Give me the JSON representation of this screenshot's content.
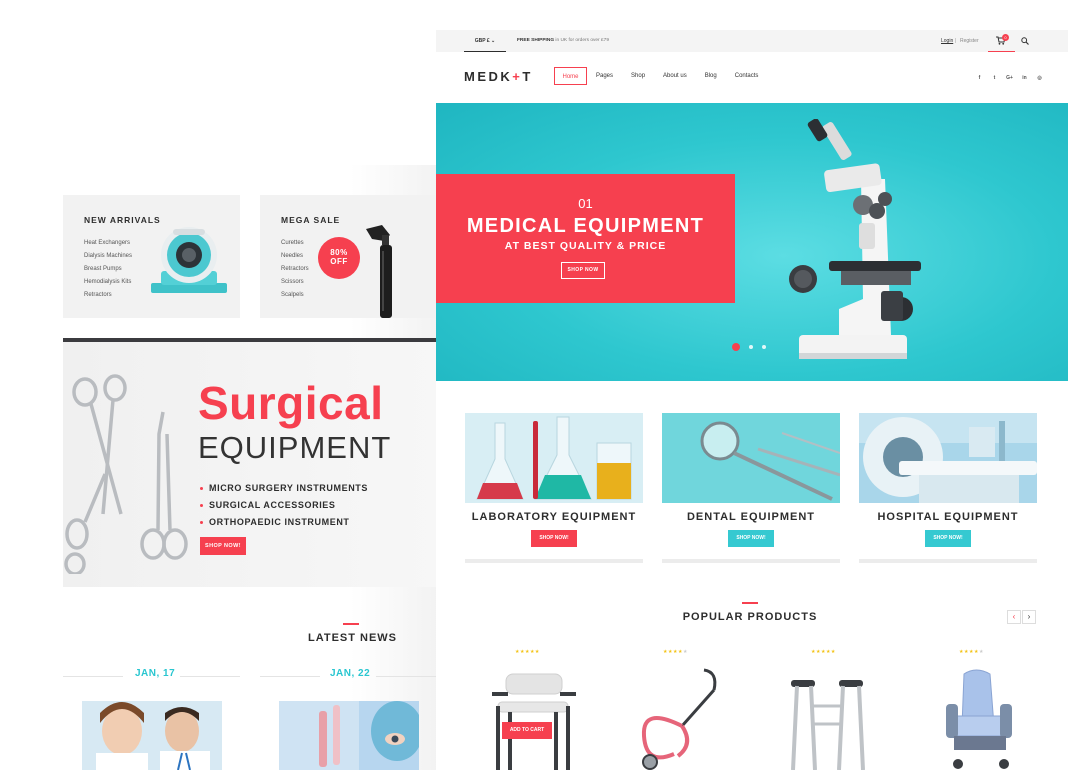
{
  "colors": {
    "accent": "#f6404f",
    "teal": "#29c6d0",
    "dark": "#2d2d2d"
  },
  "promo": {
    "new_arrivals": {
      "title": "NEW ARRIVALS",
      "items": [
        "Heat Exchangers",
        "Dialysis Machines",
        "Breast Pumps",
        "Hemodialysis Kits",
        "Retractors"
      ]
    },
    "mega_sale": {
      "title": "MEGA SALE",
      "items": [
        "Curettes",
        "Needles",
        "Retractors",
        "Scissors",
        "Scalpels"
      ],
      "badge_top": "80%",
      "badge_bottom": "OFF"
    }
  },
  "surgical": {
    "title": "Surgical",
    "subtitle": "EQUIPMENT",
    "items": [
      "MICRO SURGERY INSTRUMENTS",
      "SURGICAL ACCESSORIES",
      "ORTHOPAEDIC INSTRUMENT"
    ],
    "button": "SHOP NOW!"
  },
  "news": {
    "title": "LATEST NEWS",
    "dates": [
      "JAN, 17",
      "JAN, 22"
    ]
  },
  "topbar": {
    "currency": "GBP £",
    "shipping_bold": "FREE SHIPPING",
    "shipping_rest": " in UK for orders over £79",
    "login": "Login",
    "separator": "|",
    "register": "Register",
    "cart_count": "0"
  },
  "header": {
    "logo_left": "MEDK",
    "logo_plus": "+",
    "logo_right": "T",
    "nav": [
      "Home",
      "Pages",
      "Shop",
      "About us",
      "Blog",
      "Contacts"
    ],
    "socials": [
      "f",
      "t",
      "G+",
      "in",
      "◎"
    ]
  },
  "hero": {
    "number": "01",
    "title": "MEDICAL EQUIPMENT",
    "subtitle": "AT BEST QUALITY & PRICE",
    "button": "SHOP NOW",
    "slides": 3,
    "active_slide": 1
  },
  "categories": [
    {
      "label": "LABORATORY EQUIPMENT",
      "button": "SHOP NOW!"
    },
    {
      "label": "DENTAL EQUIPMENT",
      "button": "SHOP NOW!"
    },
    {
      "label": "HOSPITAL EQUIPMENT",
      "button": "SHOP NOW!"
    }
  ],
  "popular": {
    "title": "POPULAR PRODUCTS",
    "prev": "‹",
    "next": "›",
    "ratings": [
      5,
      4,
      5,
      4
    ],
    "add_to_cart": "ADD TO CART",
    "star_full": "★★★★★",
    "star_four": "★★★★",
    "star_off": "★"
  }
}
